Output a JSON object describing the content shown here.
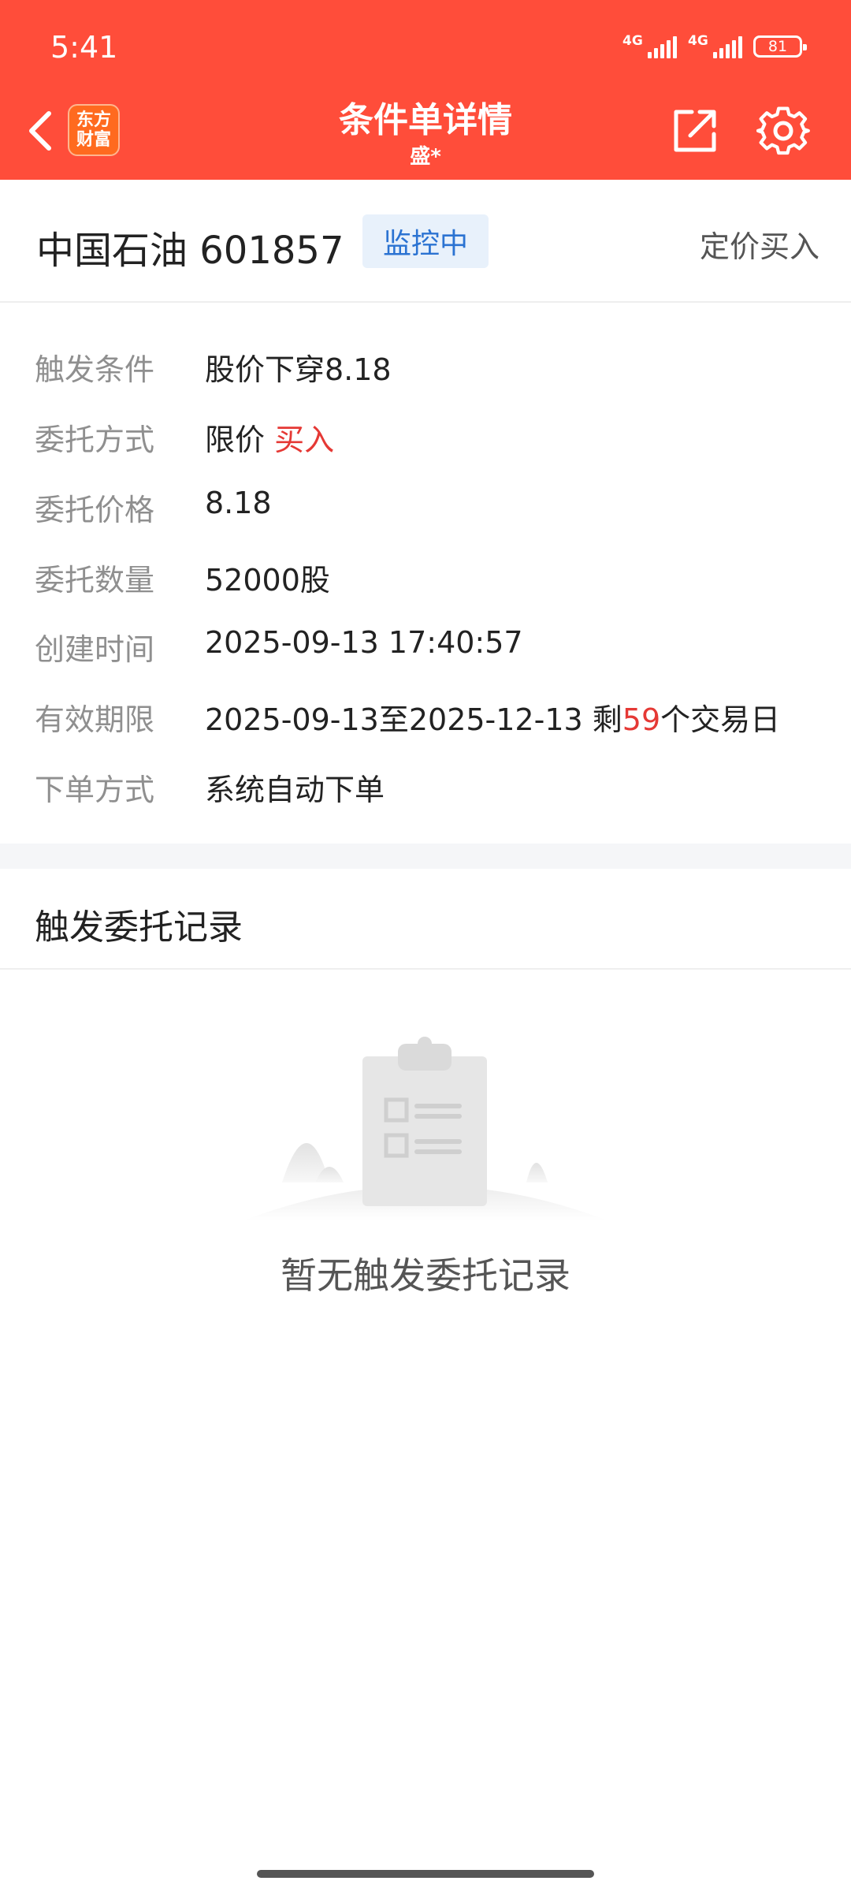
{
  "status_bar": {
    "time": "5:41",
    "network_1": "4G",
    "network_2": "4G",
    "battery": "81"
  },
  "header": {
    "title": "条件单详情",
    "account": "盛*",
    "logo_line1": "东方",
    "logo_line2": "财富",
    "icons": [
      "back-arrow-icon",
      "share-icon",
      "gear-icon"
    ],
    "background_color": "#ff4d3a"
  },
  "stock": {
    "name": "中国石油 601857",
    "status": "监控中",
    "order_type": "定价买入"
  },
  "details": {
    "trigger": {
      "label": "触发条件",
      "value": "股价下穿8.18"
    },
    "method": {
      "label": "委托方式",
      "value": "限价",
      "side": "买入"
    },
    "price": {
      "label": "委托价格",
      "value": "8.18"
    },
    "quantity": {
      "label": "委托数量",
      "value": "52000股"
    },
    "created": {
      "label": "创建时间",
      "value": "2025-09-13 17:40:57"
    },
    "validity": {
      "label": "有效期限",
      "value_prefix": "2025-09-13至2025-12-13 剩",
      "days": "59",
      "value_suffix": "个交易日"
    },
    "placement": {
      "label": "下单方式",
      "value": "系统自动下单"
    }
  },
  "records": {
    "title": "触发委托记录",
    "empty_text": "暂无触发委托记录"
  },
  "colors": {
    "accent_red": "#e53935",
    "badge_blue": "#2b73d2",
    "badge_bg": "#e8f1fb"
  }
}
